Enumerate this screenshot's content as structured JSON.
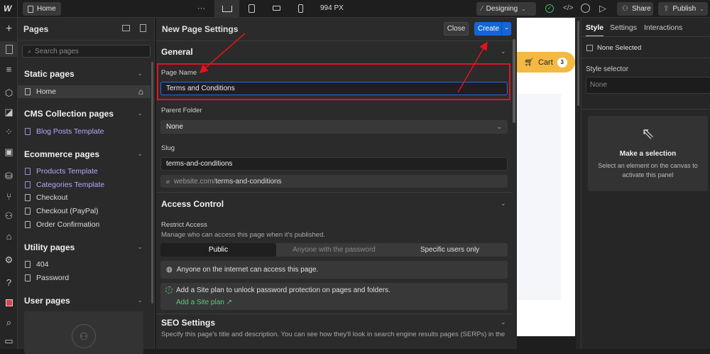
{
  "topbar": {
    "page": "Home",
    "more": "···",
    "width": "994 PX",
    "mode": "Designing",
    "share": "Share",
    "publish": "Publish"
  },
  "pages": {
    "title": "Pages",
    "search_placeholder": "Search pages",
    "sections": {
      "static": "Static pages",
      "cms": "CMS Collection pages",
      "ecommerce": "Ecommerce pages",
      "utility": "Utility pages",
      "user": "User pages"
    },
    "static_items": [
      "Home"
    ],
    "cms_items": [
      "Blog Posts Template"
    ],
    "ecommerce_items": [
      "Products Template",
      "Categories Template",
      "Checkout",
      "Checkout (PayPal)",
      "Order Confirmation"
    ],
    "utility_items": [
      "404",
      "Password"
    ]
  },
  "modal": {
    "title": "New Page Settings",
    "close": "Close",
    "create": "Create",
    "general": "General",
    "page_name_label": "Page Name",
    "page_name": "Terms and Conditions",
    "parent_label": "Parent Folder",
    "parent_value": "None",
    "slug_label": "Slug",
    "slug": "terms-and-conditions",
    "url_prefix": "website.com/",
    "url_slug": "terms-and-conditions",
    "access": "Access Control",
    "restrict": "Restrict Access",
    "restrict_desc": "Manage who can access this page when it's published.",
    "options": [
      "Public",
      "Anyone with the password",
      "Specific users only"
    ],
    "public_info": "Anyone on the internet can access this page.",
    "plan_info": "Add a Site plan to unlock password protection on pages and folders.",
    "plan_link": "Add a Site plan ↗",
    "seo": "SEO Settings",
    "seo_desc": "Specify this page's title and description. You can see how they'll look in search engine results pages (SERPs) in the"
  },
  "canvas": {
    "cart": "Cart",
    "cart_count": "3"
  },
  "right": {
    "tabs": [
      "Style",
      "Settings",
      "Interactions"
    ],
    "none_selected": "None Selected",
    "selector_label": "Style selector",
    "selector_placeholder": "None",
    "empty_title": "Make a selection",
    "empty_desc": "Select an element on the canvas to activate this panel"
  },
  "colors": {
    "accent": "#1466d6",
    "annotation": "#e0141e",
    "cart": "#f4b942",
    "template": "#b9a6ff",
    "link": "#5fc97e"
  }
}
